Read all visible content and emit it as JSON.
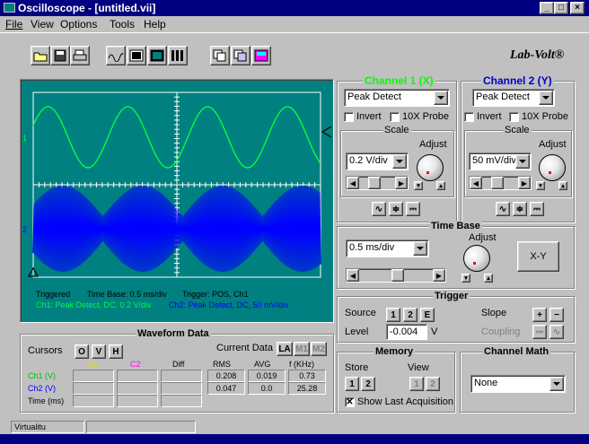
{
  "window": {
    "title": "Oscilloscope - [untitled.vii]"
  },
  "caption_buttons": [
    "_",
    "□",
    "×"
  ],
  "menu": [
    "File",
    "View",
    "Options",
    "Tools",
    "Help"
  ],
  "menu_underline": [
    "F",
    "V",
    "O",
    "T",
    "H"
  ],
  "brand": "Lab-Volt®",
  "scope": {
    "status": {
      "triggered": "Triggered",
      "timebase": "Time Base: 0.5 ms/div",
      "trigger": "Trigger: POS, Ch1",
      "ch1": "Ch1: Peak Detect, DC, 0.2 V/div",
      "ch2": "Ch2: Peak Detect, DC, 50 mV/div"
    },
    "marker_ch1": "1",
    "marker_ch2": "2",
    "colors": {
      "bg": "#008080",
      "grid": "#ffffff",
      "ch1": "#00ff40",
      "ch2": "#0000ff"
    }
  },
  "channel1": {
    "title": "Channel 1 (X)",
    "mode": "Peak Detect",
    "invert": "Invert",
    "probe": "10X Probe",
    "scale": "Scale",
    "adjust": "Adjust",
    "scale_value": "0.2 V/div"
  },
  "channel2": {
    "title": "Channel 2 (Y)",
    "mode": "Peak Detect",
    "invert": "Invert",
    "probe": "10X Probe",
    "scale": "Scale",
    "adjust": "Adjust",
    "scale_value": "50 mV/div"
  },
  "timebase": {
    "title": "Time Base",
    "value": "0.5 ms/div",
    "adjust": "Adjust",
    "xy": "X-Y"
  },
  "trigger": {
    "title": "Trigger",
    "source": "Source",
    "sources": [
      "1",
      "2",
      "E"
    ],
    "slope": "Slope",
    "level": "Level",
    "level_value": "-0.004",
    "unit": "V",
    "coupling": "Coupling"
  },
  "memory": {
    "title": "Memory",
    "store": "Store",
    "view": "View",
    "store_btns": [
      "1",
      "2"
    ],
    "view_btns": [
      "1",
      "2"
    ],
    "show_last": "Show Last Acquisition"
  },
  "math": {
    "title": "Channel Math",
    "value": "None"
  },
  "waveform": {
    "title": "Waveform Data",
    "cursors": "Cursors",
    "cursor_btns": [
      "O",
      "V",
      "H"
    ],
    "current": "Current Data",
    "current_btns": [
      "LA",
      "M1",
      "M2"
    ],
    "cols": [
      "C1",
      "C2",
      "Diff"
    ],
    "meas_cols": [
      "RMS",
      "AVG",
      "f (KHz)"
    ],
    "rows": [
      "Ch1 (V)",
      "Ch2 (V)",
      "Time (ms)"
    ],
    "ch1": [
      "0.208",
      "0.019",
      "0.73"
    ],
    "ch2": [
      "0.047",
      "0.0",
      "25.28"
    ]
  },
  "statusbar": {
    "text": "Virtualitu"
  }
}
